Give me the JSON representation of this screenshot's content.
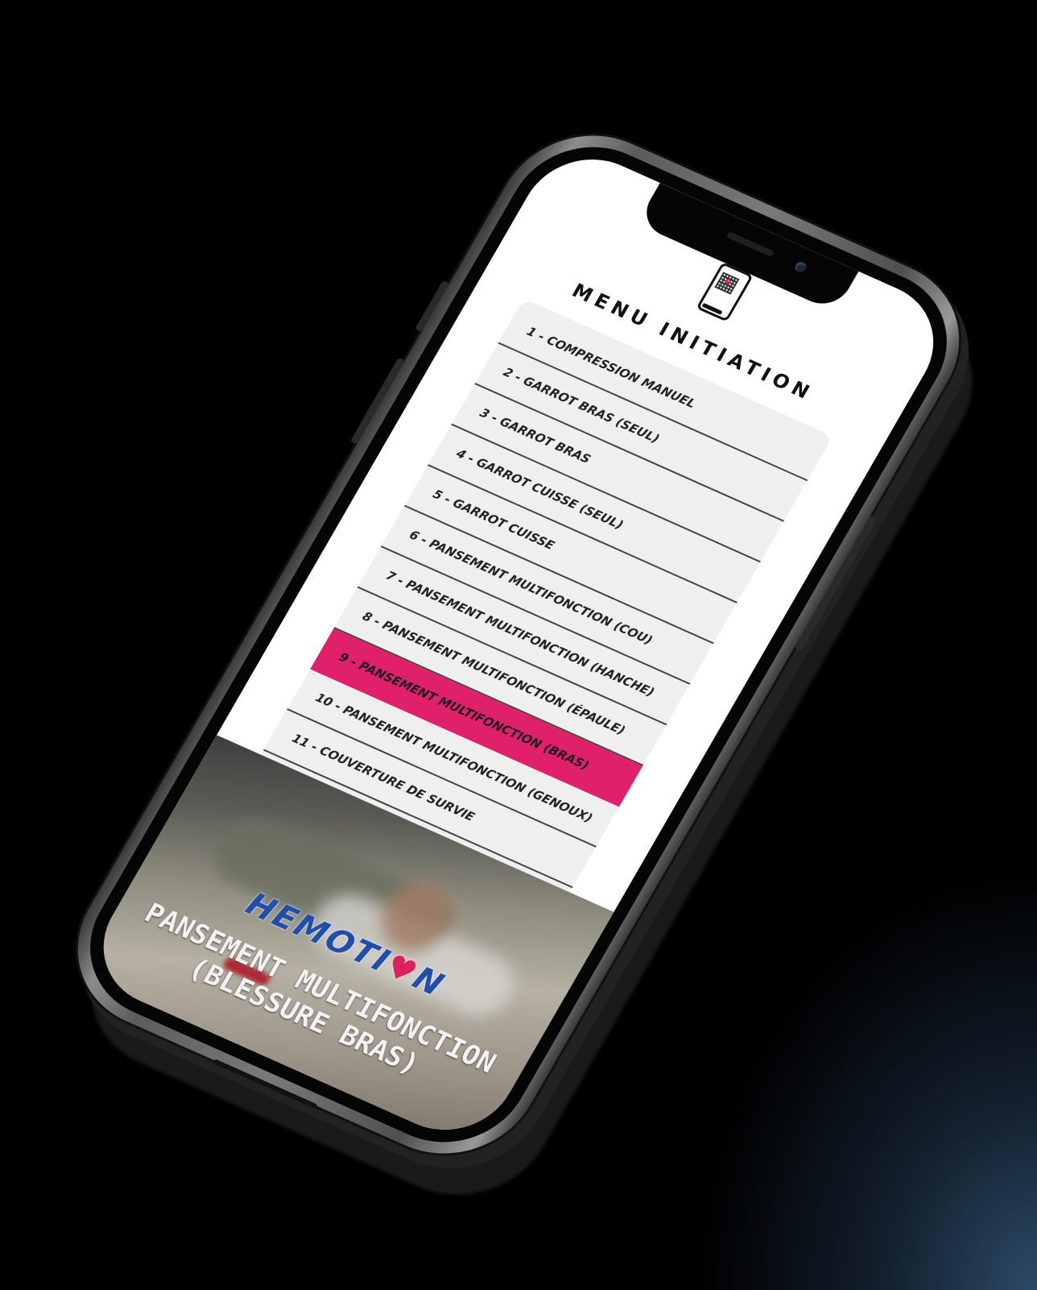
{
  "menu": {
    "title": "MENU INITIATION",
    "active_index": 8,
    "items": [
      {
        "label": "1 - COMPRESSION MANUEL"
      },
      {
        "label": "2 - GARROT BRAS (SEUL)"
      },
      {
        "label": "3 - GARROT BRAS"
      },
      {
        "label": "4 - GARROT CUISSE (SEUL)"
      },
      {
        "label": "5 - GARROT CUISSE"
      },
      {
        "label": "6 - PANSEMENT MULTIFONCTION (COU)"
      },
      {
        "label": "7 - PANSEMENT MULTIFONCTION (HANCHE)"
      },
      {
        "label": "8 - PANSEMENT MULTIFONCTION (ÉPAULE)"
      },
      {
        "label": "9 - PANSEMENT MULTIFONCTION (BRAS)"
      },
      {
        "label": "10 - PANSEMENT MULTIFONCTION (GENOUX)"
      },
      {
        "label": "11 - COUVERTURE DE SURVIE"
      }
    ]
  },
  "hero": {
    "brand_prefix": "HEMOTI",
    "brand_heart": "♥",
    "brand_suffix": "N",
    "title_line1": "PANSEMENT MULTIFONCTION",
    "title_line2": "(BLESSURE BRAS)"
  },
  "colors": {
    "accent": "#e0206a",
    "brand_blue": "#1f4fae"
  },
  "icons": {
    "header": "qr-phone-icon"
  }
}
